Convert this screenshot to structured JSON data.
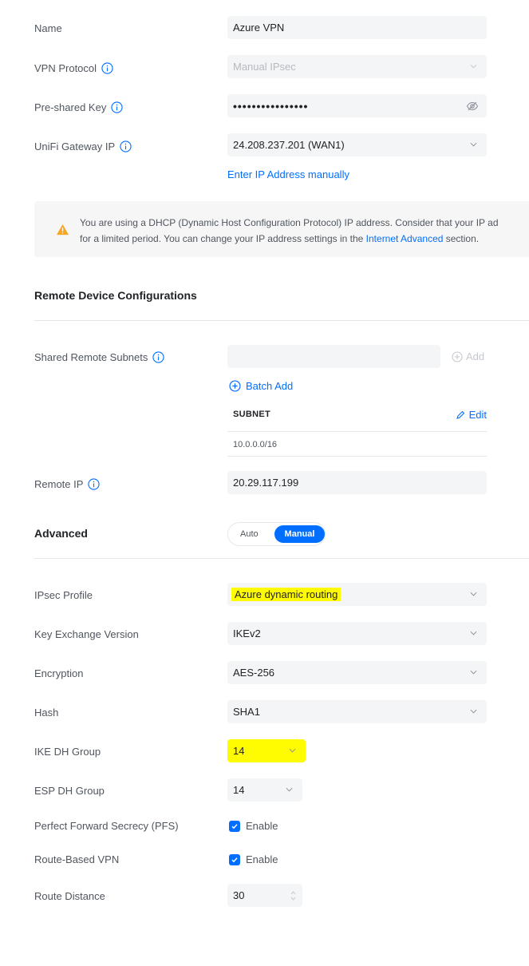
{
  "general": {
    "name_label": "Name",
    "name_value": "Azure VPN",
    "protocol_label": "VPN Protocol",
    "protocol_value": "Manual IPsec",
    "psk_label": "Pre-shared Key",
    "psk_value": "••••••••••••••••",
    "gateway_label": "UniFi Gateway IP",
    "gateway_value": "24.208.237.201 (WAN1)",
    "enter_ip_link": "Enter IP Address manually"
  },
  "notice": {
    "line1": "You are using a DHCP (Dynamic Host Configuration Protocol) IP address. Consider that your IP ad",
    "line2_pre": "for a limited period. You can change your IP address settings in the ",
    "line2_link": "Internet Advanced",
    "line2_post": " section."
  },
  "remote": {
    "section_title": "Remote Device Configurations",
    "subnets_label": "Shared Remote Subnets",
    "subnet_input_value": "",
    "add_label": "Add",
    "batch_add_label": "Batch Add",
    "subnet_col_header": "SUBNET",
    "edit_label": "Edit",
    "subnets": [
      "10.0.0.0/16"
    ],
    "remote_ip_label": "Remote IP",
    "remote_ip_value": "20.29.117.199"
  },
  "advanced": {
    "section_title": "Advanced",
    "mode_auto": "Auto",
    "mode_manual": "Manual",
    "mode_selected": "Manual",
    "ipsec_profile_label": "IPsec Profile",
    "ipsec_profile_value": "Azure dynamic routing",
    "key_exchange_label": "Key Exchange Version",
    "key_exchange_value": "IKEv2",
    "encryption_label": "Encryption",
    "encryption_value": "AES-256",
    "hash_label": "Hash",
    "hash_value": "SHA1",
    "ike_dh_label": "IKE DH Group",
    "ike_dh_value": "14",
    "esp_dh_label": "ESP DH Group",
    "esp_dh_value": "14",
    "pfs_label": "Perfect Forward Secrecy (PFS)",
    "pfs_checkbox_label": "Enable",
    "pfs_checked": true,
    "route_based_label": "Route-Based VPN",
    "route_based_checkbox_label": "Enable",
    "route_based_checked": true,
    "route_distance_label": "Route Distance",
    "route_distance_value": "30"
  },
  "colors": {
    "accent": "#006fff",
    "highlight": "#fffb00",
    "warning": "#f5a623",
    "field_bg": "#f4f5f6"
  }
}
